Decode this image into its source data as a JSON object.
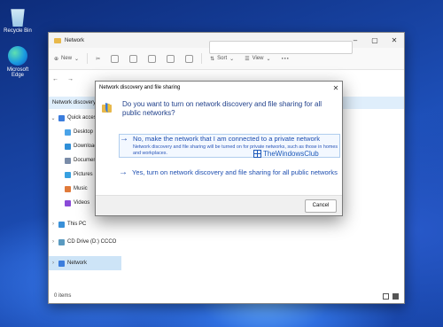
{
  "desktop": {
    "icons": [
      {
        "label": "Recycle Bin",
        "icon": "recycle-bin-icon"
      },
      {
        "label": "Microsoft Edge",
        "icon": "edge-icon"
      }
    ]
  },
  "explorer": {
    "title": "Network",
    "toolbar": {
      "new_label": "New",
      "sort_label": "Sort",
      "view_label": "View",
      "more_label": "···"
    },
    "infobar_text": "Network discovery is turned off",
    "sidebar": [
      {
        "label": "Quick access",
        "icon": "star-icon",
        "color": "#3b7ddd",
        "level": 0,
        "chevron": "⌄"
      },
      {
        "label": "Desktop",
        "icon": "desktop-icon",
        "color": "#4aa3e8",
        "level": 1
      },
      {
        "label": "Downloads",
        "icon": "download-icon",
        "color": "#2f8fd8",
        "level": 1
      },
      {
        "label": "Documents",
        "icon": "documents-icon",
        "color": "#7a8ca8",
        "level": 1
      },
      {
        "label": "Pictures",
        "icon": "pictures-icon",
        "color": "#38a0e0",
        "level": 1
      },
      {
        "label": "Music",
        "icon": "music-icon",
        "color": "#e07a3a",
        "level": 1
      },
      {
        "label": "Videos",
        "icon": "videos-icon",
        "color": "#8a4ad8",
        "level": 1
      },
      {
        "label": "This PC",
        "icon": "pc-icon",
        "color": "#3a90d8",
        "level": 0,
        "chevron": "›"
      },
      {
        "label": "CD Drive (D:) CCCO",
        "icon": "cd-drive-icon",
        "color": "#5a9ac0",
        "level": 0,
        "chevron": "›"
      },
      {
        "label": "Network",
        "icon": "network-icon",
        "color": "#3b7ddd",
        "level": 0,
        "chevron": "›",
        "selected": true
      }
    ],
    "status": "0 items"
  },
  "dialog": {
    "title": "Network discovery and file sharing",
    "question": "Do you want to turn on network discovery and file sharing for all public networks?",
    "option_private": {
      "label": "No, make the network that I am connected to a private network",
      "description": "Network discovery and file sharing will be turned on for private networks, such as those in homes and workplaces."
    },
    "option_public": {
      "label": "Yes, turn on network discovery and file sharing for all public networks"
    },
    "cancel_label": "Cancel"
  },
  "watermark": "TheWindowsClub"
}
